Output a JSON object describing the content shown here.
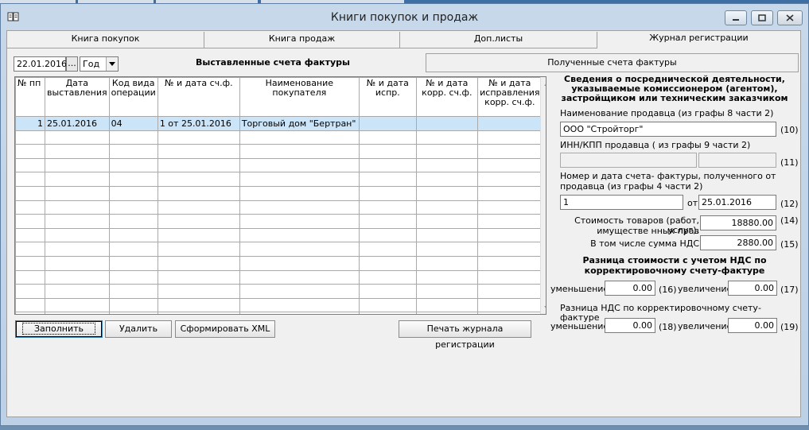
{
  "window": {
    "title": "Книги покупок и продаж"
  },
  "tabs": [
    "Книга покупок",
    "Книга продаж",
    "Доп.листы",
    "Журнал регистрации"
  ],
  "filter": {
    "date": "22.01.2016",
    "ellipsis": "...",
    "period": "Год"
  },
  "subtabs": {
    "issued": "Выставленные счета фактуры",
    "received": "Полученные счета фактуры"
  },
  "grid": {
    "columns": [
      "№ пп",
      "Дата выставления",
      "Код вида операции",
      "№ и дата сч.ф.",
      "Наименование покупателя",
      "№ и дата испр.",
      "№ и дата корр. сч.ф.",
      "№ и дата исправления корр. сч.ф."
    ],
    "rows": [
      [
        "1",
        "25.01.2016",
        "04",
        "1 от 25.01.2016",
        "Торговый дом \"Бертран\"",
        "",
        "",
        ""
      ]
    ]
  },
  "buttons": {
    "fill": "Заполнить",
    "delete": "Удалить",
    "xml": "Сформировать XML",
    "print": "Печать журнала регистрации"
  },
  "panel": {
    "header": "Сведения о посреднической деятельности, указываемые комиссионером (агентом), застройщиком или техническим заказчиком",
    "seller_name_label": "Наименование продавца (из графы 8 части 2)",
    "seller_name": "ООО \"Стройторг\"",
    "idx10": "(10)",
    "inn_label": "ИНН/КПП продавца ( из графы 9 части 2)",
    "inn": "",
    "kpp": "",
    "idx11": "(11)",
    "invoice_label_1": "Номер и дата счета- фактуры, полученного от",
    "invoice_label_2": "продавца (из графы 4 части 2)",
    "invoice_number": "1",
    "from_label": "от",
    "invoice_date": "25.01.2016",
    "idx12": "(12)",
    "cost_label_1": "Стоимость товаров (работ, услуг),",
    "cost_label_2": "имуществе нных прав",
    "cost": "18880.00",
    "idx14": "(14)",
    "vat_label": "В том числе сумма НДС",
    "vat": "2880.00",
    "idx15": "(15)",
    "diff_header_1": "Разница стоимости с учетом НДС по",
    "diff_header_2": "корректировочному счету-фактуре",
    "decrease_label": "уменьшение",
    "increase_label": "увеличение",
    "diff_decrease": "0.00",
    "idx16": "(16)",
    "diff_increase": "0.00",
    "idx17": "(17)",
    "vat_diff_label": "Разница НДС по корректировочному счету-фактуре",
    "vat_decrease": "0.00",
    "idx18": "(18)",
    "vat_increase": "0.00",
    "idx19": "(19)"
  }
}
